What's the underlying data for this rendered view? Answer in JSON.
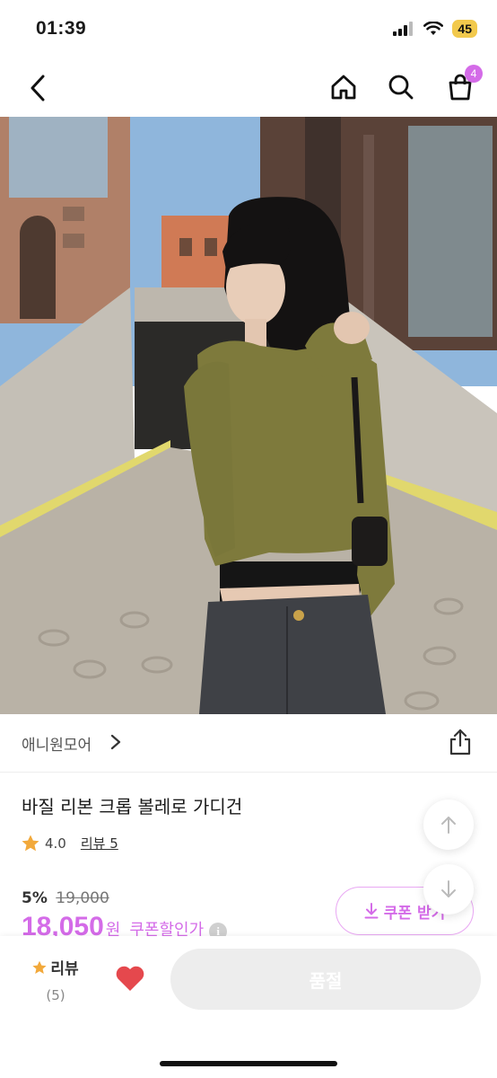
{
  "status": {
    "time": "01:39",
    "battery": "45"
  },
  "nav": {
    "cart_count": "4"
  },
  "product": {
    "store_name": "애니원모어",
    "title": "바질 리본 크롭 볼레로 가디건",
    "rating": "4.0",
    "review_link": "리뷰 5",
    "discount": "5%",
    "original_price": "19,000",
    "sale_price": "18,050",
    "currency": "원",
    "coupon_price_label": "쿠폰할인가",
    "coupon_button": "쿠폰 받기"
  },
  "bottom": {
    "review_label": "리뷰",
    "review_count": "(5)",
    "soldout_label": "품절"
  },
  "colors": {
    "accent": "#d46be8",
    "star": "#f2a93b",
    "heart": "#e5484d"
  }
}
